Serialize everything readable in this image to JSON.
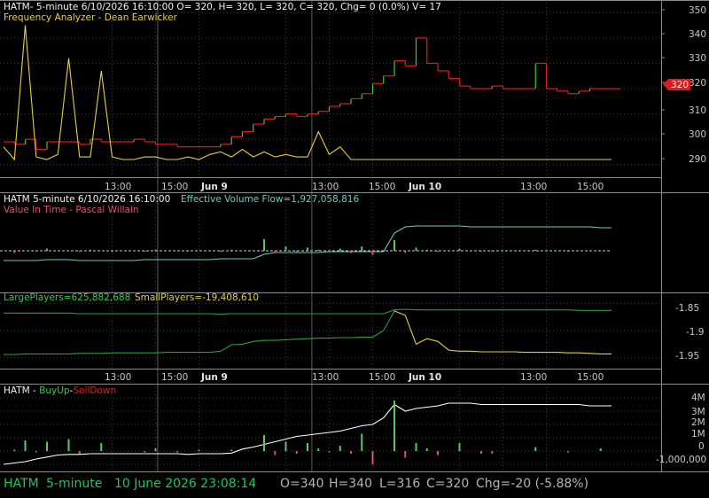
{
  "colors": {
    "background": "#000000",
    "grid": "#3b3b3b",
    "border": "#8a8a8a",
    "axis_text": "#c8c8c8",
    "price_up": "#2fcf3a",
    "price_down": "#e01b1b",
    "indicator_yellow": "#e9cf3f",
    "volume_flow": "#6fc9c4",
    "large_players": "#2e9b3a",
    "small_players": "#e0d040",
    "buyup": "#ffffff",
    "hist_up": "#5cc85c",
    "hist_down": "#e0506a",
    "price_label_bg": "#e01b1b",
    "status_green": "#22c45a",
    "status_gray": "#b5b5b5"
  },
  "panels": {
    "price": {
      "header": "HATM- 5-minute 6/10/2026 16:10:00 O= 320, H= 320, L= 320, C= 320, Chg= 0 (0.0%) V= 17",
      "subheader": "Frequency Analyzer - Dean Earwicker",
      "last_price_label": "320",
      "y_ticks": [
        "350",
        "340",
        "330",
        "320",
        "310",
        "300",
        "290"
      ]
    },
    "volume_flow": {
      "header": "HATM 5-minute  6/10/2026 16:10:00",
      "indicator_label": "Effective Volume Flow=1,927,058,816",
      "subheader": "Value In Time - Pascal Willain"
    },
    "players": {
      "large_label": "LargePlayers=625,882,688",
      "small_label": "SmallPlayers=-19,408,610",
      "y_ticks": [
        "-1.85",
        "-1.9",
        "-1.95"
      ]
    },
    "buyup": {
      "title_prefix": "HATM - ",
      "buy_label": "BuyUp",
      "dash": "-",
      "sell_label": "SellDown",
      "y_ticks": [
        "4M",
        "3M",
        "2M",
        "1M",
        "0",
        "-1,000,000"
      ]
    }
  },
  "x_axis": {
    "ticks": [
      "13:00",
      "15:00",
      "Jun 9",
      "13:00",
      "15:00",
      "Jun 10",
      "13:00",
      "15:00"
    ]
  },
  "status_bar": {
    "symbol": "HATM",
    "interval": "5-minute",
    "datetime": "10 June 2026 23:08:14",
    "open": "O=340",
    "high": "H=340",
    "low": "L=316",
    "close": "C=320",
    "change": "Chg=-20 (-5.88%)"
  },
  "chart_data": [
    {
      "type": "line",
      "title": "HATM- 5-minute 6/10/2026 16:10:00 O= 320, H= 320, L= 320, C= 320, Chg= 0 (0.0%) V= 17",
      "series": [
        {
          "name": "HATM",
          "values": [
            299,
            298,
            300,
            296,
            299,
            299,
            299,
            298,
            300,
            299,
            299,
            299,
            300,
            299,
            298,
            298,
            297,
            297,
            297,
            297,
            298,
            301,
            303,
            306,
            308,
            309,
            310,
            309,
            310,
            311,
            313,
            314,
            316,
            318,
            322,
            325,
            331,
            329,
            340,
            330,
            327,
            324,
            321,
            320,
            320,
            321,
            320,
            320,
            320,
            330,
            320,
            319,
            318,
            319,
            320,
            320,
            320
          ]
        },
        {
          "name": "Frequency Analyzer - Dean Earwicker",
          "values": [
            297,
            292,
            345,
            293,
            292,
            294,
            332,
            293,
            293,
            327,
            293,
            292,
            292,
            293,
            293,
            292,
            292,
            293,
            292,
            294,
            295,
            293,
            296,
            293,
            295,
            293,
            294,
            293,
            293,
            303,
            294,
            297,
            292,
            292,
            292,
            292,
            292,
            292,
            292,
            292,
            292,
            292,
            292,
            292,
            292,
            292,
            292,
            292,
            292,
            292,
            292,
            292,
            292,
            292,
            292,
            292,
            292
          ]
        }
      ],
      "ylim": [
        285,
        355
      ],
      "y_ticks": [
        290,
        300,
        310,
        320,
        330,
        340,
        350
      ]
    },
    {
      "type": "line",
      "title": "HATM 5-minute  6/10/2026 16:10:00",
      "series": [
        {
          "name": "Effective Volume Flow",
          "values": [
            -11,
            -11,
            -11,
            -11,
            -10,
            -10,
            -10,
            -11,
            -11,
            -11,
            -11,
            -11,
            -11,
            -10,
            -10,
            -10,
            -10,
            -10,
            -10,
            -10,
            -9,
            -9,
            -9,
            -9,
            -4,
            -2,
            -2,
            -2,
            -2,
            -2,
            -1,
            -1,
            -1,
            -1,
            -1,
            -1,
            20,
            27,
            28,
            28,
            28,
            28,
            28,
            27,
            27,
            27,
            27,
            27,
            27,
            27,
            27,
            27,
            27,
            27,
            27,
            26,
            26
          ]
        },
        {
          "name": "Value In Time - Pascal Willain",
          "values": [
            0,
            -2,
            0,
            -1,
            2,
            0,
            0,
            -1,
            1,
            0,
            -1,
            0,
            0,
            -1,
            1,
            0,
            0,
            -1,
            0,
            0,
            -1,
            1,
            0,
            0,
            11,
            -2,
            4,
            -1,
            3,
            1,
            -1,
            2,
            -2,
            4,
            -4,
            0,
            10,
            -2,
            3,
            1,
            -1,
            0,
            2,
            0,
            -1,
            -1,
            0,
            0,
            0,
            1,
            0,
            0,
            -1,
            0,
            0,
            0,
            0
          ]
        }
      ]
    },
    {
      "type": "line",
      "series": [
        {
          "name": "LargePlayers",
          "values": [
            -1.868,
            -1.868,
            -1.868,
            -1.868,
            -1.868,
            -1.868,
            -1.868,
            -1.869,
            -1.869,
            -1.869,
            -1.869,
            -1.869,
            -1.869,
            -1.869,
            -1.869,
            -1.869,
            -1.869,
            -1.869,
            -1.869,
            -1.869,
            -1.87,
            -1.869,
            -1.869,
            -1.869,
            -1.869,
            -1.869,
            -1.869,
            -1.869,
            -1.869,
            -1.869,
            -1.869,
            -1.869,
            -1.869,
            -1.869,
            -1.869,
            -1.869,
            -1.862,
            -1.861,
            -1.862,
            -1.862,
            -1.862,
            -1.862,
            -1.862,
            -1.862,
            -1.862,
            -1.862,
            -1.862,
            -1.862,
            -1.862,
            -1.862,
            -1.862,
            -1.862,
            -1.862,
            -1.863,
            -1.863,
            -1.863,
            -1.863
          ]
        },
        {
          "name": "SmallPlayers",
          "values": [
            -1.944,
            -1.944,
            -1.943,
            -1.943,
            -1.943,
            -1.943,
            -1.943,
            -1.942,
            -1.942,
            -1.942,
            -1.941,
            -1.941,
            -1.941,
            -1.941,
            -1.941,
            -1.94,
            -1.94,
            -1.94,
            -1.94,
            -1.94,
            -1.938,
            -1.926,
            -1.925,
            -1.92,
            -1.918,
            -1.918,
            -1.917,
            -1.916,
            -1.915,
            -1.914,
            -1.914,
            -1.913,
            -1.913,
            -1.912,
            -1.912,
            -1.9,
            -1.864,
            -1.872,
            -1.925,
            -1.915,
            -1.92,
            -1.936,
            -1.938,
            -1.938,
            -1.939,
            -1.939,
            -1.939,
            -1.939,
            -1.94,
            -1.94,
            -1.94,
            -1.94,
            -1.941,
            -1.941,
            -1.942,
            -1.943,
            -1.943
          ]
        }
      ],
      "ylim": [
        -1.97,
        -1.83
      ],
      "y_ticks": [
        -1.85,
        -1.9,
        -1.95
      ]
    },
    {
      "type": "bar",
      "title": "HATM - BuyUp-SellDown",
      "series": [
        {
          "name": "BuyUp-SellDown",
          "values": [
            -1000000,
            -900000,
            -800000,
            -600000,
            -450000,
            -300000,
            -250000,
            -250000,
            -200000,
            -200000,
            -200000,
            -200000,
            -200000,
            -200000,
            -200000,
            -200000,
            -200000,
            -250000,
            -200000,
            -200000,
            -200000,
            -150000,
            150000,
            300000,
            500000,
            700000,
            900000,
            1100000,
            1200000,
            1300000,
            1400000,
            1500000,
            1700000,
            1900000,
            2000000,
            2500000,
            3500000,
            3000000,
            3200000,
            3300000,
            3400000,
            3600000,
            3600000,
            3600000,
            3500000,
            3500000,
            3500000,
            3500000,
            3500000,
            3500000,
            3500000,
            3500000,
            3500000,
            3500000,
            3400000,
            3400000,
            3400000
          ]
        },
        {
          "name": "histogram",
          "values": [
            0,
            100000,
            800000,
            -100000,
            700000,
            0,
            900000,
            -200000,
            0,
            600000,
            0,
            0,
            0,
            -100000,
            200000,
            0,
            -100000,
            0,
            100000,
            0,
            0,
            100000,
            0,
            0,
            1200000,
            -300000,
            700000,
            -200000,
            600000,
            200000,
            -100000,
            400000,
            -200000,
            1300000,
            -1000000,
            0,
            3800000,
            -500000,
            600000,
            200000,
            -300000,
            0,
            600000,
            0,
            -200000,
            -200000,
            0,
            0,
            0,
            300000,
            0,
            0,
            -100000,
            0,
            0,
            200000,
            0
          ]
        }
      ],
      "ylim": [
        -1600000,
        4800000
      ],
      "y_ticks": [
        -1000000,
        0,
        1000000,
        2000000,
        3000000,
        4000000
      ]
    }
  ]
}
